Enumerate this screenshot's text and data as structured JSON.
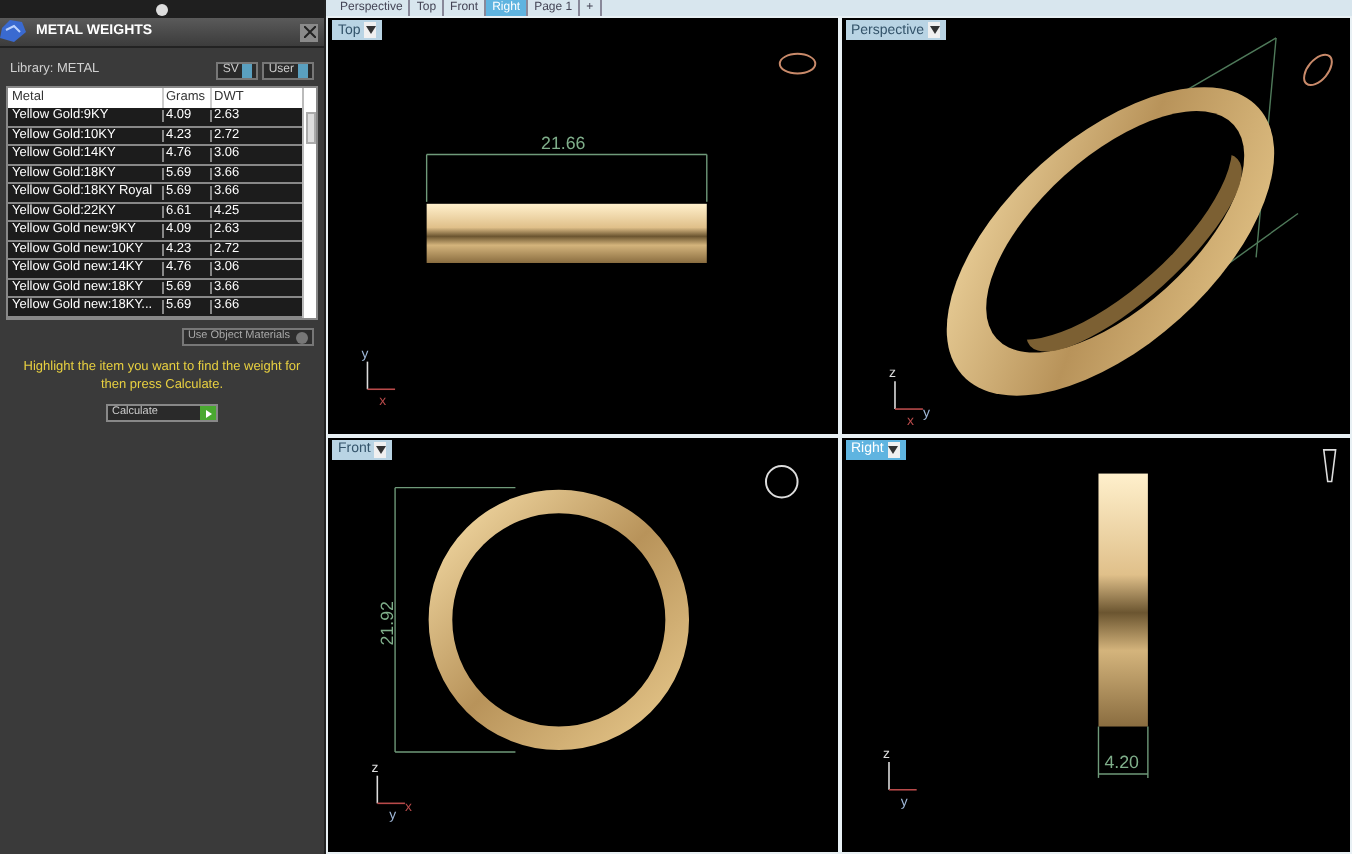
{
  "viewport_tabs": [
    {
      "label": "Perspective",
      "selected": false
    },
    {
      "label": "Top",
      "selected": false
    },
    {
      "label": "Front",
      "selected": false
    },
    {
      "label": "Right",
      "selected": true
    },
    {
      "label": "Page 1",
      "selected": false
    },
    {
      "label": "+",
      "selected": false
    }
  ],
  "panel": {
    "title": "METAL WEIGHTS",
    "library": "Library: METAL",
    "library_buttons": [
      "SV",
      "User"
    ],
    "table": {
      "columns": [
        "Metal",
        "Grams",
        "DWT"
      ],
      "rows": [
        [
          "Yellow Gold:9KY",
          "4.09",
          "2.63"
        ],
        [
          "Yellow Gold:10KY",
          "4.23",
          "2.72"
        ],
        [
          "Yellow Gold:14KY",
          "4.76",
          "3.06"
        ],
        [
          "Yellow Gold:18KY",
          "5.69",
          "3.66"
        ],
        [
          "Yellow Gold:18KY Royal",
          "5.69",
          "3.66"
        ],
        [
          "Yellow Gold:22KY",
          "6.61",
          "4.25"
        ],
        [
          "Yellow Gold new:9KY",
          "4.09",
          "2.63"
        ],
        [
          "Yellow Gold new:10KY",
          "4.23",
          "2.72"
        ],
        [
          "Yellow Gold new:14KY",
          "4.76",
          "3.06"
        ],
        [
          "Yellow Gold new:18KY",
          "5.69",
          "3.66"
        ],
        [
          "Yellow Gold new:18KY...",
          "5.69",
          "3.66"
        ]
      ]
    },
    "materials_button": "Use Object Materials",
    "hint": "Highlight the item you want to find the weight for then press Calculate.",
    "calculate": "Calculate"
  },
  "viewports": [
    {
      "kind": "top",
      "label": "Top",
      "selected": false,
      "dimension": "21.66",
      "axes": [
        "y",
        "x"
      ]
    },
    {
      "kind": "perspective",
      "label": "Perspective",
      "selected": false,
      "axes": [
        "z",
        "x",
        "y"
      ]
    },
    {
      "kind": "front",
      "label": "Front",
      "selected": false,
      "dimension": "21.92",
      "axes": [
        "z",
        "y",
        "x"
      ]
    },
    {
      "kind": "right",
      "label": "Right",
      "selected": true,
      "dimension": "4.20",
      "axes": [
        "z",
        "y"
      ]
    }
  ]
}
